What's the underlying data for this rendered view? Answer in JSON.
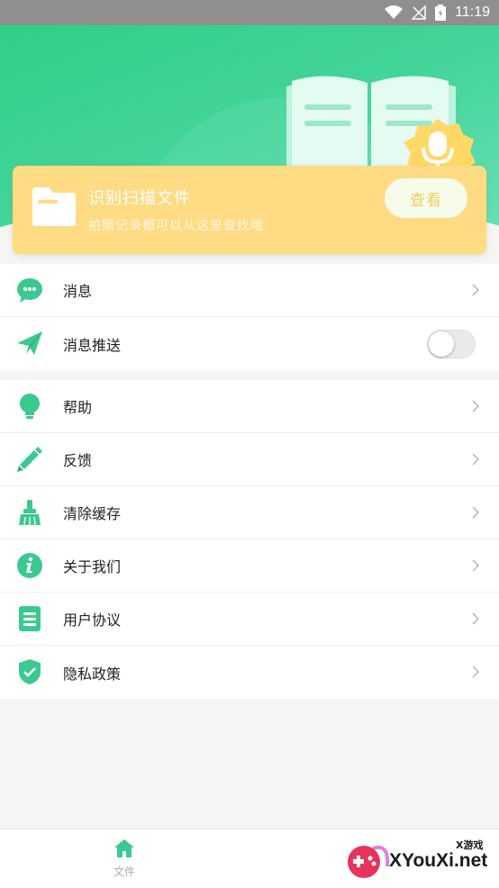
{
  "status_bar": {
    "time": "11:19"
  },
  "scan_card": {
    "title": "识别扫描文件",
    "subtitle": "拍照记录都可以从这里查找哦",
    "view_button": "查看"
  },
  "group1": [
    {
      "label": "消息",
      "icon": "message-bubble-icon",
      "control": "chevron"
    },
    {
      "label": "消息推送",
      "icon": "paper-plane-icon",
      "control": "toggle",
      "toggle_on": false
    }
  ],
  "group2": [
    {
      "label": "帮助",
      "icon": "lightbulb-icon"
    },
    {
      "label": "反馈",
      "icon": "pencil-icon"
    },
    {
      "label": "清除缓存",
      "icon": "broom-icon"
    },
    {
      "label": "关于我们",
      "icon": "info-icon"
    },
    {
      "label": "用户协议",
      "icon": "document-list-icon"
    },
    {
      "label": "隐私政策",
      "icon": "shield-check-icon"
    }
  ],
  "bottom_nav": {
    "home_label": "文件"
  },
  "watermark": {
    "text": "XYouXi.net",
    "small": "X游戏"
  },
  "colors": {
    "accent": "#2fd088",
    "card": "#ffdb84",
    "icon_green": "#3cc98f"
  }
}
